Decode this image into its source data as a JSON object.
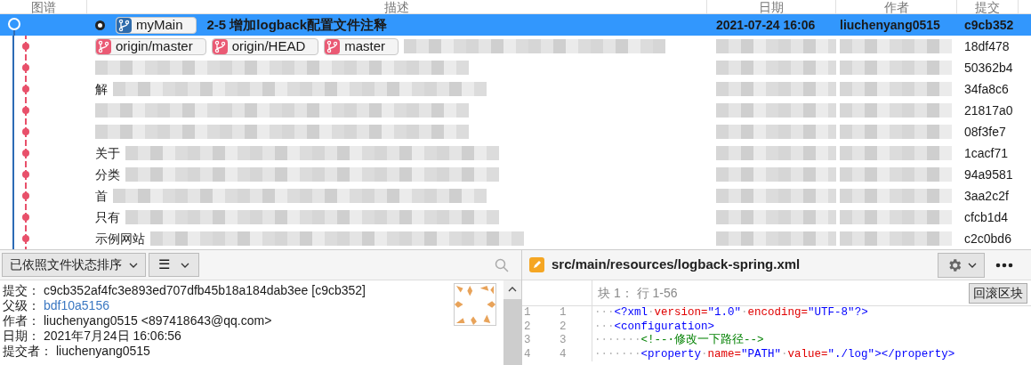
{
  "columns": [
    "图谱",
    "描述",
    "日期",
    "作者",
    "提交"
  ],
  "commits": [
    {
      "selected": true,
      "head": true,
      "branches": [
        {
          "name": "myMain",
          "kind": "current"
        }
      ],
      "description": "2-5 增加logback配置文件注释",
      "date": "2021-07-24 16:06",
      "author": "liuchenyang0515",
      "hash": "c9cb352"
    },
    {
      "selected": false,
      "head": false,
      "branches": [
        {
          "name": "origin/master",
          "kind": "other"
        },
        {
          "name": "origin/HEAD",
          "kind": "other"
        },
        {
          "name": "master",
          "kind": "other"
        }
      ],
      "hash": "18df478"
    },
    {
      "selected": false,
      "head": false,
      "hash": "50362b4"
    },
    {
      "selected": false,
      "head": false,
      "description": "解",
      "hash": "34fa8c6"
    },
    {
      "selected": false,
      "head": false,
      "hash": "21817a0"
    },
    {
      "selected": false,
      "head": false,
      "hash": "08f3fe7"
    },
    {
      "selected": false,
      "head": false,
      "description": "关于",
      "hash": "1cacf71"
    },
    {
      "selected": false,
      "head": false,
      "description": "分类",
      "hash": "94a9581"
    },
    {
      "selected": false,
      "head": false,
      "description": "首",
      "hash": "3aa2c2f"
    },
    {
      "selected": false,
      "head": false,
      "description": "只有",
      "hash": "cfcb1d4"
    },
    {
      "selected": false,
      "head": false,
      "description": "示例网站",
      "hash": "c2c0bd6"
    }
  ],
  "toolbar": {
    "sort": "已依照文件状态排序",
    "view_icon": "☰"
  },
  "details": [
    {
      "label": "提交：",
      "value": "c9cb352af4fc3e893ed707dfb45b18a184dab3ee [c9cb352]",
      "kind": "text"
    },
    {
      "label": "父级：",
      "value": "bdf10a5156",
      "kind": "link"
    },
    {
      "label": "作者：",
      "value": "liuchenyang0515 <897418643@qq.com>",
      "kind": "text"
    },
    {
      "label": "日期：",
      "value": "2021年7月24日 16:06:56",
      "kind": "text"
    },
    {
      "label": "提交者：",
      "value": "liuchenyang0515",
      "kind": "text"
    }
  ],
  "file": {
    "path": "src/main/resources/logback-spring.xml",
    "hunk": "块 1： 行 1-56",
    "revert_button": "回滚区块"
  },
  "code": [
    {
      "old": "1",
      "new": "1",
      "tokens": [
        {
          "kind": "ws",
          "text": "···"
        },
        {
          "kind": "tag",
          "text": "<?xml"
        },
        {
          "kind": "ws",
          "text": "·"
        },
        {
          "kind": "attr",
          "text": "version="
        },
        {
          "kind": "value",
          "text": "\"1.0\""
        },
        {
          "kind": "ws",
          "text": "·"
        },
        {
          "kind": "attr",
          "text": "encoding="
        },
        {
          "kind": "value",
          "text": "\"UTF-8\""
        },
        {
          "kind": "tag",
          "text": "?>"
        }
      ]
    },
    {
      "old": "2",
      "new": "2",
      "tokens": [
        {
          "kind": "ws",
          "text": "···"
        },
        {
          "kind": "tag",
          "text": "<configuration>"
        }
      ]
    },
    {
      "old": "3",
      "new": "3",
      "tokens": [
        {
          "kind": "ws",
          "text": "·······"
        },
        {
          "kind": "comment",
          "text": "<!--·修改一下路径-->"
        }
      ]
    },
    {
      "old": "4",
      "new": "4",
      "tokens": [
        {
          "kind": "ws",
          "text": "·······"
        },
        {
          "kind": "tag",
          "text": "<property"
        },
        {
          "kind": "ws",
          "text": "·"
        },
        {
          "kind": "attr",
          "text": "name="
        },
        {
          "kind": "value",
          "text": "\"PATH\""
        },
        {
          "kind": "ws",
          "text": "·"
        },
        {
          "kind": "attr",
          "text": "value="
        },
        {
          "kind": "value",
          "text": "\"./log\""
        },
        {
          "kind": "tag",
          "text": "></property>"
        }
      ]
    }
  ]
}
